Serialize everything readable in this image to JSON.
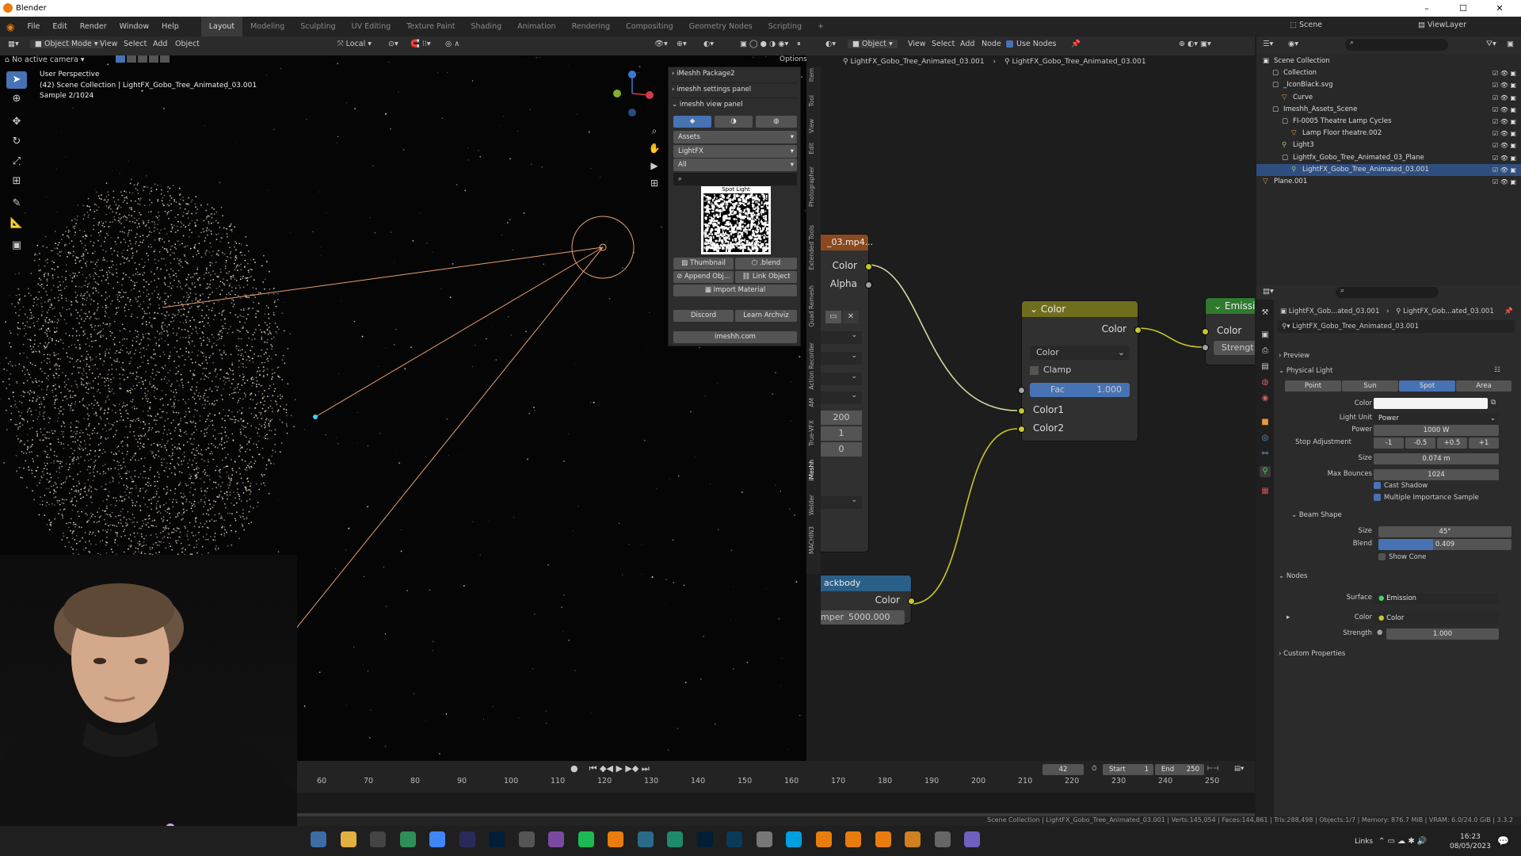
{
  "window": {
    "title": "Blender",
    "minimize": "–",
    "maximize": "☐",
    "close": "✕"
  },
  "menu": [
    "File",
    "Edit",
    "Render",
    "Window",
    "Help"
  ],
  "workspaces": [
    "Layout",
    "Modeling",
    "Sculpting",
    "UV Editing",
    "Texture Paint",
    "Shading",
    "Animation",
    "Rendering",
    "Compositing",
    "Geometry Nodes",
    "Scripting"
  ],
  "scene": {
    "label": "Scene",
    "viewlayer": "ViewLayer"
  },
  "viewport": {
    "mode": "Object Mode",
    "menus": [
      "View",
      "Select",
      "Add",
      "Object"
    ],
    "orientation": "Local",
    "camera_status": "No active camera",
    "options": "Options",
    "overlay_lines": [
      "User Perspective",
      "(42) Scene Collection | LightFX_Gobo_Tree_Animated_03.001",
      "Sample 2/1024"
    ]
  },
  "imeshh": {
    "header1": "iMeshh Package2",
    "header2": "imeshh settings panel",
    "header3": "imeshh view panel",
    "dropdowns": [
      "Assets",
      "LightFX",
      "All"
    ],
    "preview_caption": "Spot Light",
    "thumbnail": "Thumbnail",
    "blend": ".blend",
    "append": "Append Obj...",
    "link": "Link Object",
    "import": "Import Material",
    "discord": "Discord",
    "learn": "Learn Archviz",
    "site": "imeshh.com"
  },
  "side_tabs": [
    "Item",
    "Tool",
    "View",
    "Edit",
    "Photographer",
    "Extended Tools",
    "Quad Remesh",
    "Action Recorder",
    "AM",
    "True-VFX",
    "iMeshh",
    "Welder",
    "MACHIN3"
  ],
  "node_editor": {
    "menus": [
      "Object",
      "View",
      "Select",
      "Add",
      "Node"
    ],
    "use_nodes": "Use Nodes",
    "breadcrumb": [
      "LightFX_Gobo_Tree_Animated_03.001",
      "LightFX_Gobo_Tree_Animated_03.001"
    ],
    "image_node": {
      "title": "_03.mp4...",
      "out_color": "Color",
      "out_alpha": "Alpha",
      "vals": [
        "200",
        "1",
        "0"
      ]
    },
    "mix_node": {
      "title": "Color",
      "out": "Color",
      "blend": "Color",
      "clamp": "Clamp",
      "fac_label": "Fac",
      "fac_value": "1.000",
      "in1": "Color1",
      "in2": "Color2"
    },
    "emission_node": {
      "title": "Emissio",
      "in_color": "Color",
      "in_strength": "Strengt"
    },
    "blackbody_node": {
      "title": "ackbody",
      "out": "Color",
      "temp_label": "mper",
      "temp_value": "5000.000"
    }
  },
  "outliner": {
    "items": [
      {
        "label": "Scene Collection"
      },
      {
        "label": "Collection"
      },
      {
        "label": "_IconBlack.svg"
      },
      {
        "label": "Curve"
      },
      {
        "label": "Imeshh_Assets_Scene"
      },
      {
        "label": "FI-0005 Theatre Lamp Cycles"
      },
      {
        "label": "Lamp Floor theatre.002"
      },
      {
        "label": "Light3"
      },
      {
        "label": "Lightfx_Gobo_Tree_Animated_03_Plane"
      },
      {
        "label": "LightFX_Gobo_Tree_Animated_03.001"
      },
      {
        "label": "Plane.001"
      }
    ]
  },
  "properties": {
    "breadcrumb": [
      "LightFX_Gob...ated_03.001",
      "LightFX_Gob...ated_03.001"
    ],
    "datablock": "LightFX_Gobo_Tree_Animated_03.001",
    "preview": "Preview",
    "physical_light": "Physical Light",
    "light_types": [
      "Point",
      "Sun",
      "Spot",
      "Area"
    ],
    "active_type": "Spot",
    "color_label": "Color",
    "light_unit_label": "Light Unit",
    "light_unit": "Power",
    "power_label": "Power",
    "power": "1000 W",
    "stop_label": "Stop Adjustment",
    "stops": [
      "-1",
      "-0.5",
      "+0.5",
      "+1"
    ],
    "size_label": "Size",
    "size": "0.074 m",
    "bounces_label": "Max Bounces",
    "bounces": "1024",
    "cast_shadow": "Cast Shadow",
    "mis": "Multiple Importance Sample",
    "beam_shape": "Beam Shape",
    "beam_size_label": "Size",
    "beam_size": "45°",
    "blend_label": "Blend",
    "blend": "0.409",
    "blend_fraction": 0.409,
    "show_cone": "Show Cone",
    "nodes": "Nodes",
    "surface_label": "Surface",
    "surface": "Emission",
    "ncolor_label": "Color",
    "ncolor": "Color",
    "strength_label": "Strength",
    "strength": "1.000",
    "custom": "Custom Properties"
  },
  "timeline": {
    "current_frame": "42",
    "start_label": "Start",
    "start": "1",
    "end_label": "End",
    "end": "250",
    "ticks": [
      "60",
      "70",
      "80",
      "90",
      "100",
      "110",
      "120",
      "130",
      "140",
      "150",
      "160",
      "170",
      "180",
      "190",
      "200",
      "210",
      "220",
      "230",
      "240",
      "250"
    ]
  },
  "status": "Scene Collection | LightFX_Gobo_Tree_Animated_03.001 | Verts:145,054 | Faces:144,861 | Tris:288,498 | Objects:1/7 | Memory: 876.7 MiB | VRAM: 6.0/24.0 GiB | 3.3.2",
  "taskbar": {
    "links": "Links",
    "time": "16:23",
    "date": "08/05/2023"
  },
  "colors": {
    "accent": "#4772b3",
    "socket_yellow": "#c7c729",
    "mix_header": "#6e6e1d",
    "emission_header": "#2f7a2f",
    "blackbody_header": "#2a5f87",
    "image_header": "#8a4a1e"
  }
}
